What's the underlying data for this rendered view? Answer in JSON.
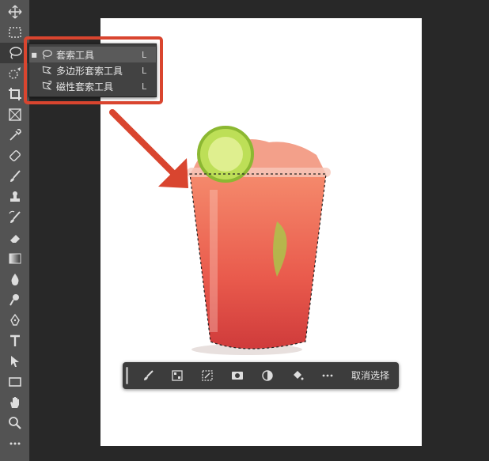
{
  "tool_flyout": {
    "items": [
      {
        "label": "套索工具",
        "shortcut": "L",
        "icon": "lasso-icon",
        "selected": true
      },
      {
        "label": "多边形套索工具",
        "shortcut": "L",
        "icon": "polygonal-lasso-icon",
        "selected": false
      },
      {
        "label": "磁性套索工具",
        "shortcut": "L",
        "icon": "magnetic-lasso-icon",
        "selected": false
      }
    ]
  },
  "toolbar": {
    "tools": [
      "move-icon",
      "marquee-icon",
      "lasso-icon",
      "quick-select-icon",
      "crop-icon",
      "frame-icon",
      "eyedropper-icon",
      "healing-icon",
      "brush-icon",
      "stamp-icon",
      "history-brush-icon",
      "eraser-icon",
      "gradient-icon",
      "blur-icon",
      "dodge-icon",
      "pen-icon",
      "type-icon",
      "path-select-icon",
      "rectangle-icon",
      "hand-icon",
      "zoom-icon",
      "more-icon"
    ],
    "active": "lasso-icon"
  },
  "contextual_bar": {
    "deselect_label": "取消选择",
    "buttons": [
      "select-subject-icon",
      "select-mask-icon",
      "transform-selection-icon",
      "mask-icon",
      "adjustment-icon",
      "fill-icon",
      "more-icon"
    ]
  },
  "colors": {
    "highlight": "#d9452f",
    "panel": "#535353",
    "background": "#282828"
  }
}
